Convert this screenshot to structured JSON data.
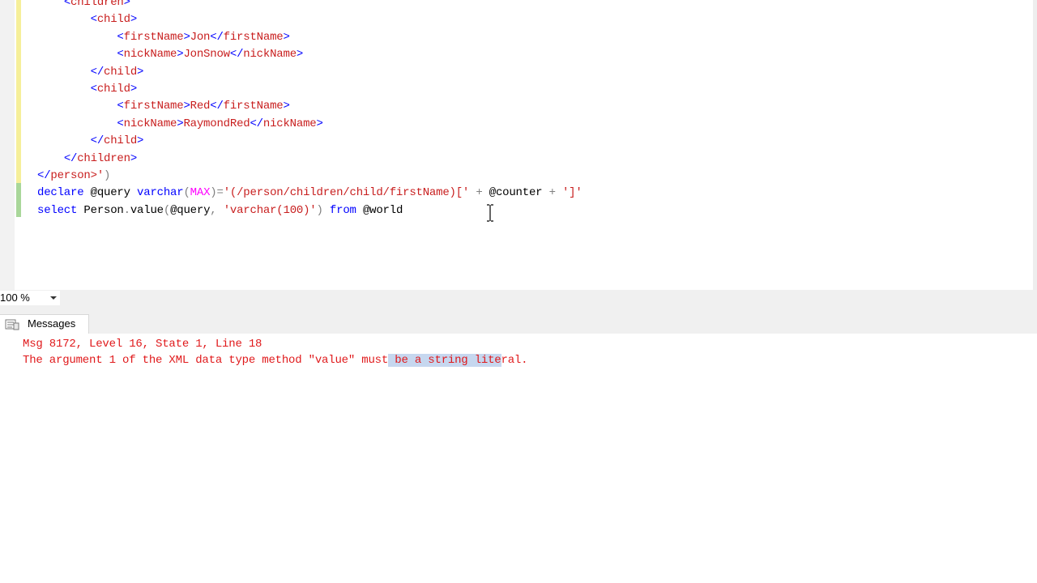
{
  "editor": {
    "lines": [
      {
        "segments": [
          {
            "t": "    ",
            "c": "plain"
          },
          {
            "t": "<",
            "c": "ang"
          },
          {
            "t": "children",
            "c": "tag"
          },
          {
            "t": ">",
            "c": "ang"
          }
        ]
      },
      {
        "segments": [
          {
            "t": "        ",
            "c": "plain"
          },
          {
            "t": "<",
            "c": "ang"
          },
          {
            "t": "child",
            "c": "tag"
          },
          {
            "t": ">",
            "c": "ang"
          }
        ]
      },
      {
        "segments": [
          {
            "t": "            ",
            "c": "plain"
          },
          {
            "t": "<",
            "c": "ang"
          },
          {
            "t": "firstName",
            "c": "tag"
          },
          {
            "t": ">",
            "c": "ang"
          },
          {
            "t": "Jon",
            "c": "tag"
          },
          {
            "t": "</",
            "c": "ang"
          },
          {
            "t": "firstName",
            "c": "tag"
          },
          {
            "t": ">",
            "c": "ang"
          }
        ]
      },
      {
        "segments": [
          {
            "t": "            ",
            "c": "plain"
          },
          {
            "t": "<",
            "c": "ang"
          },
          {
            "t": "nickName",
            "c": "tag"
          },
          {
            "t": ">",
            "c": "ang"
          },
          {
            "t": "JonSnow",
            "c": "tag"
          },
          {
            "t": "</",
            "c": "ang"
          },
          {
            "t": "nickName",
            "c": "tag"
          },
          {
            "t": ">",
            "c": "ang"
          }
        ]
      },
      {
        "segments": [
          {
            "t": "        ",
            "c": "plain"
          },
          {
            "t": "</",
            "c": "ang"
          },
          {
            "t": "child",
            "c": "tag"
          },
          {
            "t": ">",
            "c": "ang"
          }
        ]
      },
      {
        "segments": [
          {
            "t": "        ",
            "c": "plain"
          },
          {
            "t": "<",
            "c": "ang"
          },
          {
            "t": "child",
            "c": "tag"
          },
          {
            "t": ">",
            "c": "ang"
          }
        ]
      },
      {
        "segments": [
          {
            "t": "            ",
            "c": "plain"
          },
          {
            "t": "<",
            "c": "ang"
          },
          {
            "t": "firstName",
            "c": "tag"
          },
          {
            "t": ">",
            "c": "ang"
          },
          {
            "t": "Red",
            "c": "tag"
          },
          {
            "t": "</",
            "c": "ang"
          },
          {
            "t": "firstName",
            "c": "tag"
          },
          {
            "t": ">",
            "c": "ang"
          }
        ]
      },
      {
        "segments": [
          {
            "t": "            ",
            "c": "plain"
          },
          {
            "t": "<",
            "c": "ang"
          },
          {
            "t": "nickName",
            "c": "tag"
          },
          {
            "t": ">",
            "c": "ang"
          },
          {
            "t": "RaymondRed",
            "c": "tag"
          },
          {
            "t": "</",
            "c": "ang"
          },
          {
            "t": "nickName",
            "c": "tag"
          },
          {
            "t": ">",
            "c": "ang"
          }
        ]
      },
      {
        "segments": [
          {
            "t": "        ",
            "c": "plain"
          },
          {
            "t": "</",
            "c": "ang"
          },
          {
            "t": "child",
            "c": "tag"
          },
          {
            "t": ">",
            "c": "ang"
          }
        ]
      },
      {
        "segments": [
          {
            "t": "    ",
            "c": "plain"
          },
          {
            "t": "</",
            "c": "ang"
          },
          {
            "t": "children",
            "c": "tag"
          },
          {
            "t": ">",
            "c": "ang"
          }
        ]
      },
      {
        "segments": [
          {
            "t": "</",
            "c": "ang"
          },
          {
            "t": "person",
            "c": "tag"
          },
          {
            "t": ">'",
            "c": "str"
          },
          {
            "t": ")",
            "c": "grey"
          }
        ]
      },
      {
        "segments": [
          {
            "t": "declare",
            "c": "kw"
          },
          {
            "t": " @query ",
            "c": "plain"
          },
          {
            "t": "varchar",
            "c": "kw"
          },
          {
            "t": "(",
            "c": "grey"
          },
          {
            "t": "MAX",
            "c": "pink"
          },
          {
            "t": ")=",
            "c": "grey"
          },
          {
            "t": "'(/person/children/child/firstName)['",
            "c": "str"
          },
          {
            "t": " + ",
            "c": "grey"
          },
          {
            "t": "@counter",
            "c": "plain"
          },
          {
            "t": " + ",
            "c": "grey"
          },
          {
            "t": "']'",
            "c": "str"
          }
        ]
      },
      {
        "segments": [
          {
            "t": "select",
            "c": "kw"
          },
          {
            "t": " Person",
            "c": "plain"
          },
          {
            "t": ".",
            "c": "grey"
          },
          {
            "t": "value",
            "c": "plain"
          },
          {
            "t": "(",
            "c": "grey"
          },
          {
            "t": "@query",
            "c": "plain"
          },
          {
            "t": ", ",
            "c": "grey"
          },
          {
            "t": "'varchar(100)'",
            "c": "str"
          },
          {
            "t": ")",
            "c": "grey"
          },
          {
            "t": " from ",
            "c": "kw"
          },
          {
            "t": "@world",
            "c": "plain"
          }
        ]
      }
    ]
  },
  "zoom": {
    "value": "100 %"
  },
  "results": {
    "tab_label": "Messages",
    "message_line1": "Msg 8172, Level 16, State 1, Line 18",
    "message_line2_before": "The argument 1 of the XML data type method \"value\" must",
    "message_line2_selected": " be a string lite",
    "message_line2_after": "ral."
  },
  "colors": {
    "keyword": "#0000ff",
    "string": "#c81e1e",
    "error_text": "#e0191b",
    "selection": "#c6d7ef",
    "change_bar_saved": "#f6ef9a",
    "change_bar_new": "#a9d79a"
  },
  "icons": {
    "ibeam": "text-cursor-icon",
    "messages": "messages-icon",
    "zoom_dropdown": "chevron-down-icon"
  }
}
